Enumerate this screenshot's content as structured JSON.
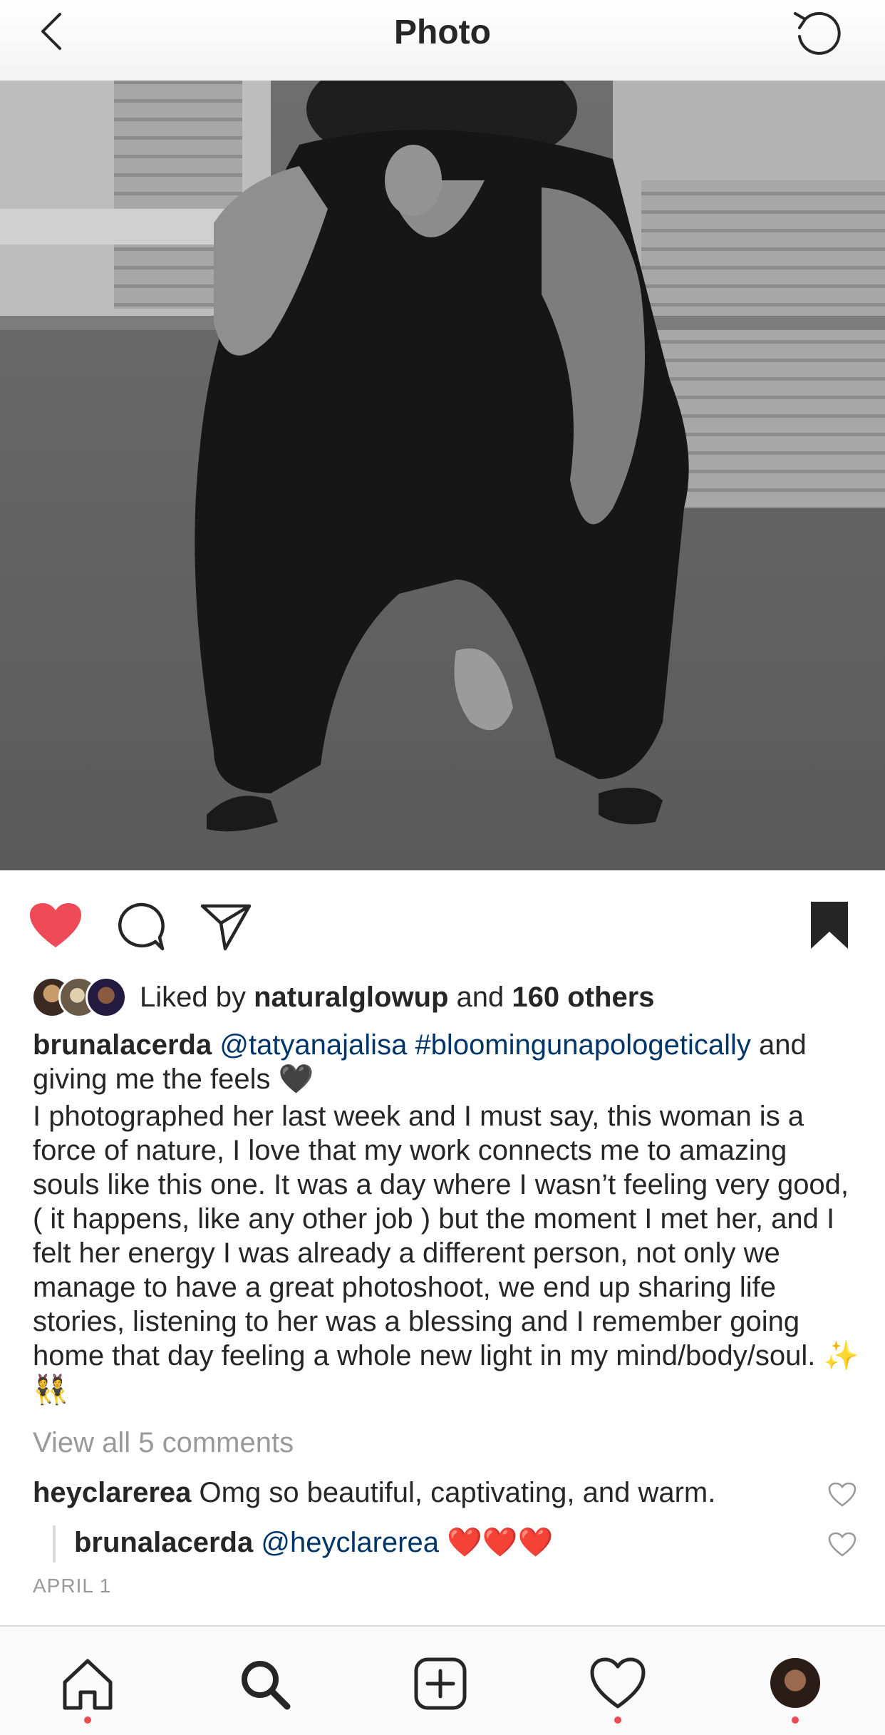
{
  "header": {
    "title": "Photo"
  },
  "post": {
    "likes": {
      "prefix": "Liked by ",
      "user": "naturalglowup",
      "middle": " and ",
      "others": "160 others"
    },
    "caption": {
      "author": "brunalacerda",
      "mention": "@tatyanajalisa",
      "hashtag": "#bloomingunapologetically",
      "line1_rest": "and giving me the feels 🖤",
      "body": "I photographed her last week and I must say, this woman is a force of nature, I love that my work connects me to amazing souls like this one. It was a day where I wasn’t feeling very good, ( it happens, like any other job ) but the moment I met her, and I felt her energy I was already a different person, not only we manage to have a great photoshoot, we end up sharing life stories, listening to her was a blessing and I remember going home that day feeling a whole new light in my mind/body/soul. ✨👯"
    },
    "view_all_comments": "View all 5 comments",
    "comments": [
      {
        "user": "heyclarerea",
        "text": "Omg so beautiful, captivating, and warm."
      },
      {
        "user": "brunalacerda",
        "mention": "@heyclarerea",
        "text": "❤️❤️❤️"
      }
    ],
    "date": "APRIL 1"
  },
  "icons": {
    "back": "chevron-left-icon",
    "refresh": "refresh-icon",
    "like": "heart-filled-icon",
    "comment": "comment-bubble-icon",
    "share": "paper-plane-icon",
    "save": "bookmark-filled-icon",
    "tabs": [
      "home-icon",
      "search-icon",
      "add-post-icon",
      "activity-heart-icon",
      "profile-avatar"
    ]
  },
  "colors": {
    "like_red": "#ed4956",
    "link_blue": "#003569",
    "muted_gray": "#999999",
    "notification_dot": "#ed4956"
  }
}
